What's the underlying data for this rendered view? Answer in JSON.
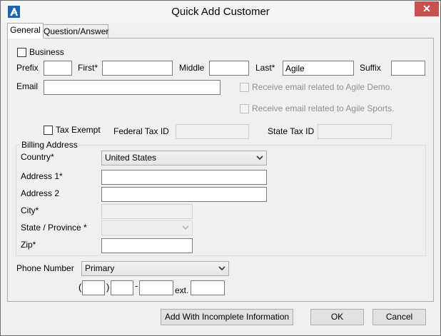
{
  "window": {
    "title": "Quick Add Customer",
    "close_label": "✕"
  },
  "tabs": [
    {
      "label": "General",
      "active": true
    },
    {
      "label": "Question/Answer",
      "active": false
    }
  ],
  "business": {
    "label": "Business",
    "checked": false
  },
  "name": {
    "prefix_label": "Prefix",
    "prefix_value": "",
    "first_label": "First*",
    "first_value": "",
    "middle_label": "Middle",
    "middle_value": "",
    "last_label": "Last*",
    "last_value": "Agile",
    "suffix_label": "Suffix",
    "suffix_value": ""
  },
  "email": {
    "label": "Email",
    "value": "",
    "opt_demo": "Receive email related to Agile Demo.",
    "opt_sports": "Receive email related to Agile Sports."
  },
  "tax": {
    "exempt_label": "Tax Exempt",
    "federal_label": "Federal Tax ID",
    "federal_value": "",
    "state_label": "State Tax ID",
    "state_value": ""
  },
  "billing": {
    "title": "Billing Address",
    "country_label": "Country*",
    "country_value": "United States",
    "address1_label": "Address 1*",
    "address1_value": "",
    "address2_label": "Address 2",
    "address2_value": "",
    "city_label": "City*",
    "city_value": "",
    "state_label": "State / Province *",
    "state_value": "",
    "zip_label": "Zip*",
    "zip_value": ""
  },
  "phone": {
    "label": "Phone Number",
    "type_value": "Primary",
    "open_paren": "(",
    "close_paren": ")",
    "dash": "-",
    "ext_label": "ext."
  },
  "buttons": {
    "add_incomplete": "Add With Incomplete Information",
    "ok": "OK",
    "cancel": "Cancel"
  },
  "colors": {
    "close_bg": "#c75050",
    "logo_blue": "#1e64b4",
    "window_bg": "#f0f0f0"
  }
}
